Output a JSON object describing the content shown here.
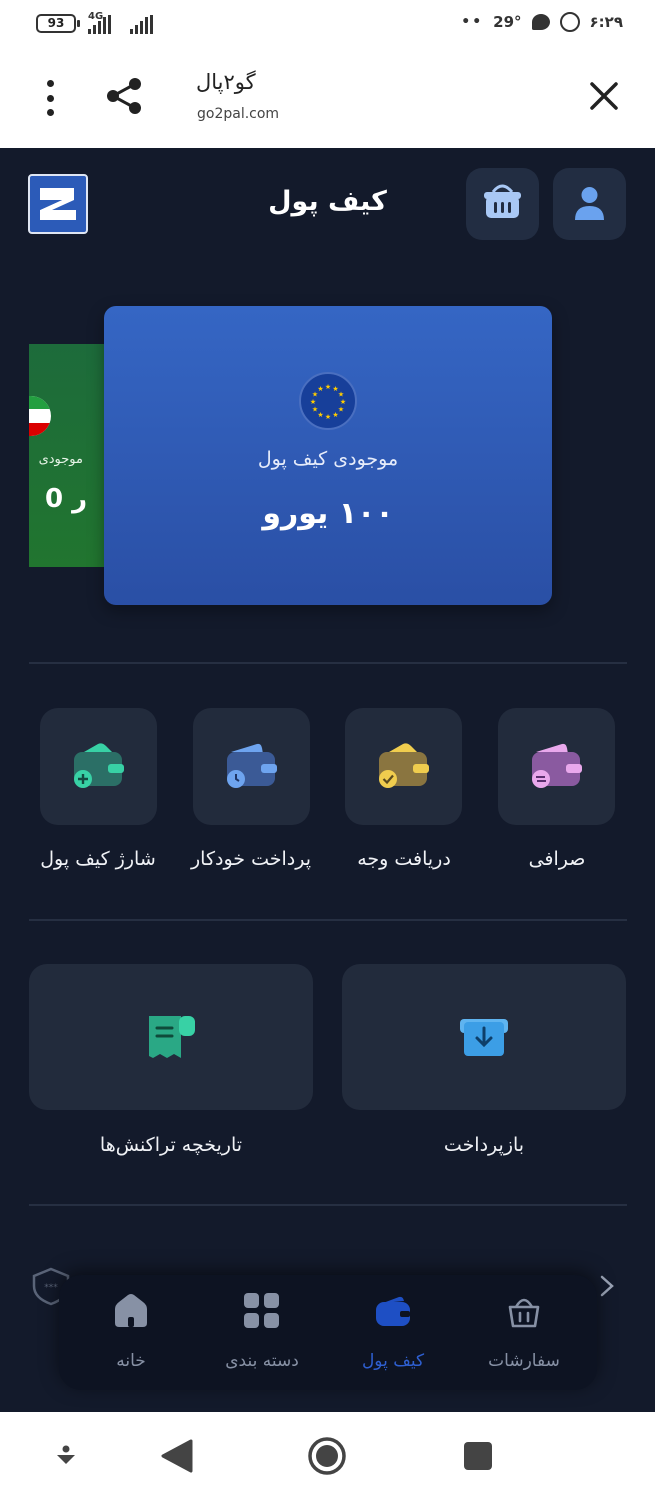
{
  "status_bar": {
    "battery": "93",
    "network": "4G",
    "dots": "••",
    "temperature": "29°",
    "time": "۶:۲۹"
  },
  "browser": {
    "title": "گو۲پال",
    "url": "go2pal.com"
  },
  "header": {
    "title": "کیف پول"
  },
  "cards": {
    "side_card": {
      "label": "موجودی",
      "amount": "0 ر"
    },
    "main_card": {
      "label": "موجودی کیف پول",
      "amount": "۱۰۰ یورو"
    }
  },
  "actions": [
    {
      "label": "صرافی",
      "icon": "exchange-wallet-icon",
      "color": "#d77ad6"
    },
    {
      "label": "دریافت وجه",
      "icon": "receive-wallet-icon",
      "color": "#e4c24a"
    },
    {
      "label": "پرداخت خودکار",
      "icon": "auto-pay-wallet-icon",
      "color": "#5b8fe0"
    },
    {
      "label": "شارژ کیف پول",
      "icon": "charge-wallet-icon",
      "color": "#2fc29b"
    }
  ],
  "big_actions": [
    {
      "label": "بازپرداخت",
      "icon": "refund-icon",
      "color": "#3c9ee6"
    },
    {
      "label": "تاریخچه تراکنش‌ها",
      "icon": "receipt-icon",
      "color": "#2fc29b"
    }
  ],
  "bottom_nav": [
    {
      "label": "سفارشات",
      "icon": "basket-icon",
      "active": false
    },
    {
      "label": "کیف پول",
      "icon": "wallet-icon",
      "active": true
    },
    {
      "label": "دسته بندی",
      "icon": "grid-icon",
      "active": false
    },
    {
      "label": "خانه",
      "icon": "home-icon",
      "active": false
    }
  ],
  "colors": {
    "background": "#131a2b",
    "tile": "#222b3c",
    "card_blue": "#3566c4",
    "card_green": "#1d6b3b",
    "active": "#2e5fd0"
  }
}
